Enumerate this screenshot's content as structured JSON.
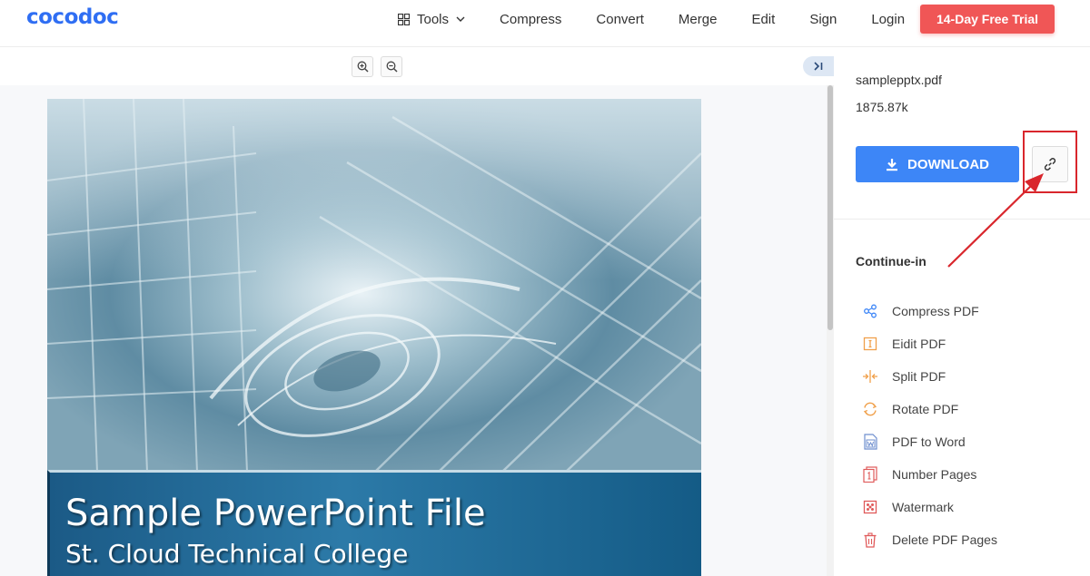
{
  "header": {
    "logo": "cocodoc",
    "nav": {
      "tools_label": "Tools",
      "compress_label": "Compress",
      "convert_label": "Convert",
      "merge_label": "Merge",
      "edit_label": "Edit",
      "sign_label": "Sign",
      "login_label": "Login"
    },
    "trial_button": "14-Day Free Trial"
  },
  "viewer": {
    "slide": {
      "title": "Sample PowerPoint File",
      "subtitle": "St. Cloud Technical College"
    }
  },
  "side_panel": {
    "file_name": "samplepptx.pdf",
    "file_size": "1875.87k",
    "download_label": "DOWNLOAD",
    "continue_title": "Continue-in",
    "tools": [
      {
        "label": "Compress PDF",
        "icon": "share-nodes-icon",
        "color": "#3d86f7"
      },
      {
        "label": "Eidit PDF",
        "icon": "edit-cursor-icon",
        "color": "#f0a04b"
      },
      {
        "label": "Split PDF",
        "icon": "split-icon",
        "color": "#f0a04b"
      },
      {
        "label": "Rotate PDF",
        "icon": "rotate-icon",
        "color": "#f0a04b"
      },
      {
        "label": "PDF to Word",
        "icon": "word-doc-icon",
        "color": "#6f8fcf"
      },
      {
        "label": "Number Pages",
        "icon": "number-pages-icon",
        "color": "#e05a5a"
      },
      {
        "label": "Watermark",
        "icon": "watermark-icon",
        "color": "#e05a5a"
      },
      {
        "label": "Delete PDF Pages",
        "icon": "trash-icon",
        "color": "#e05a5a"
      }
    ]
  },
  "colors": {
    "brand": "#2f6ef3",
    "trial": "#f05656",
    "download": "#3d86f7",
    "annotation": "#d9262c"
  }
}
